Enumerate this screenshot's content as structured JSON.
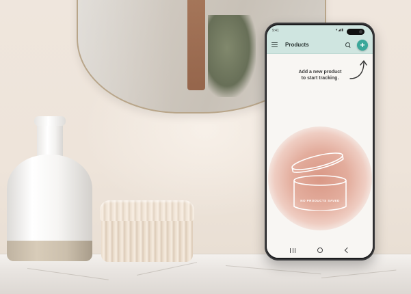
{
  "status_bar": {
    "time": "9:41",
    "icons": "▾◢▮"
  },
  "app_bar": {
    "title": "Products",
    "add_label": "+"
  },
  "hint": {
    "line1": "Add a new product",
    "line2": "to start tracking."
  },
  "empty_state": {
    "label": "NO PRODUCTS SAVED"
  },
  "colors": {
    "accent": "#3aa79a",
    "app_bar_bg": "#cfe5e0",
    "empty_glow": "#d99886"
  },
  "icons": {
    "menu": "menu-icon",
    "search": "search-icon",
    "add": "add-icon",
    "recent": "recent-apps-icon",
    "home": "home-icon",
    "back": "back-icon"
  }
}
